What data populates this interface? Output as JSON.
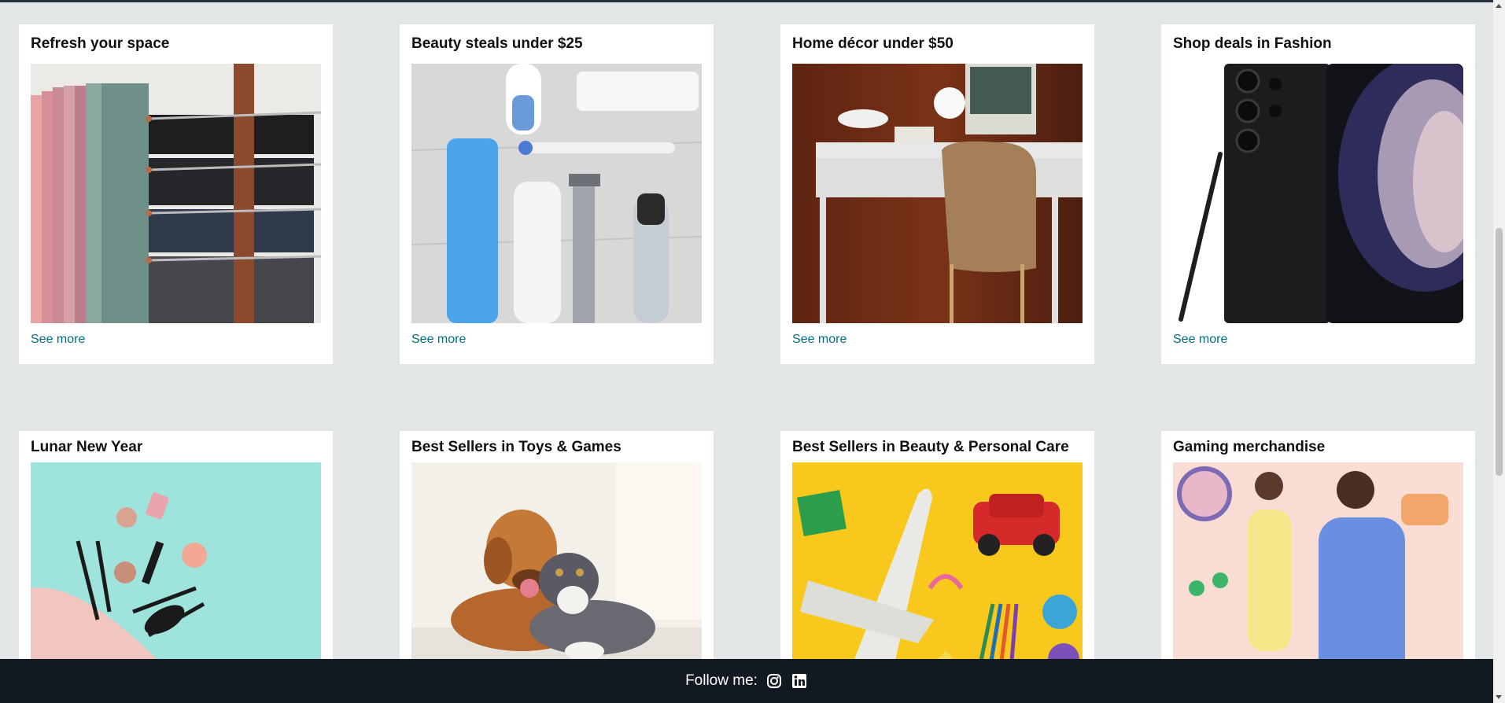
{
  "cards": [
    {
      "title": "Refresh your space",
      "link": "See more",
      "image": "hangers-with-pants-image"
    },
    {
      "title": "Beauty steals under $25",
      "link": "See more",
      "image": "toiletries-flatlay-image"
    },
    {
      "title": "Home décor under $50",
      "link": "See more",
      "image": "desk-and-chair-image"
    },
    {
      "title": "Shop deals in Fashion",
      "link": "See more",
      "image": "smartphone-with-stylus-image"
    },
    {
      "title": "Lunar New Year",
      "image": "makeup-bag-image"
    },
    {
      "title": "Best Sellers in Toys & Games",
      "image": "dog-and-cat-image"
    },
    {
      "title": "Best Sellers in Beauty & Personal Care",
      "image": "toy-airplane-and-car-image"
    },
    {
      "title": "Gaming merchandise",
      "image": "fashion-models-image"
    }
  ],
  "footer": {
    "follow_label": "Follow me:",
    "icons": [
      "instagram-icon",
      "linkedin-icon"
    ]
  },
  "colors": {
    "page_bg": "#e3e6e6",
    "card_bg": "#ffffff",
    "link": "#007185",
    "footer_bg": "#131921"
  }
}
